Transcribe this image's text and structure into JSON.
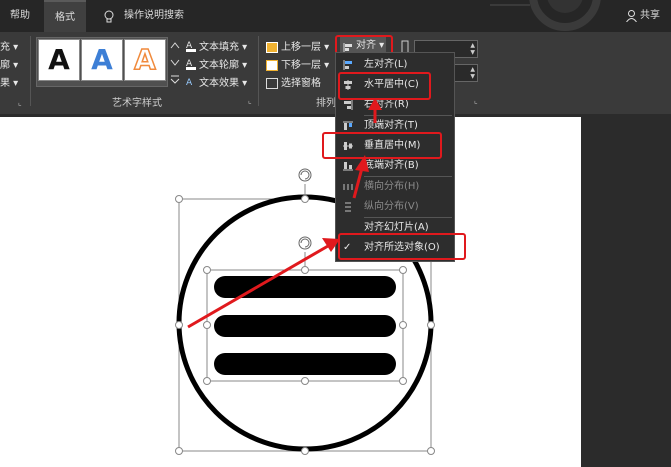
{
  "tabs": {
    "help": "帮助",
    "format": "格式",
    "search": "操作说明搜索",
    "share": "共享"
  },
  "ribbon": {
    "left_partial": [
      "充 ▾",
      "廓 ▾",
      "果 ▾"
    ],
    "art_letter": "A",
    "art_group_label": "艺术字样式",
    "text_fill": "文本填充 ▾",
    "text_outline": "文本轮廓 ▾",
    "text_effects": "文本效果 ▾",
    "bring_forward": "上移一层 ▾",
    "send_backward": "下移一层 ▾",
    "selection_pane": "选择窗格",
    "arrange_label": "排列",
    "align_button": "对齐 ▾"
  },
  "align_menu": {
    "items": [
      {
        "label": "左对齐(L)",
        "enabled": true,
        "checked": false
      },
      {
        "label": "水平居中(C)",
        "enabled": true,
        "checked": false
      },
      {
        "label": "右对齐(R)",
        "enabled": true,
        "checked": false
      },
      {
        "label": "顶端对齐(T)",
        "enabled": true,
        "checked": false
      },
      {
        "label": "垂直居中(M)",
        "enabled": true,
        "checked": false
      },
      {
        "label": "底端对齐(B)",
        "enabled": true,
        "checked": false
      },
      {
        "label": "横向分布(H)",
        "enabled": false,
        "checked": false
      },
      {
        "label": "纵向分布(V)",
        "enabled": false,
        "checked": false
      },
      {
        "label": "对齐幻灯片(A)",
        "enabled": true,
        "checked": false
      },
      {
        "label": "对齐所选对象(O)",
        "enabled": true,
        "checked": true
      }
    ]
  },
  "colors": {
    "highlight_red": "#e0191d",
    "ribbon_bg": "#3a3a3a",
    "menu_bg": "#2d2d2d",
    "art_blue": "#3d7fd6",
    "art_orange": "#f08a3c"
  }
}
